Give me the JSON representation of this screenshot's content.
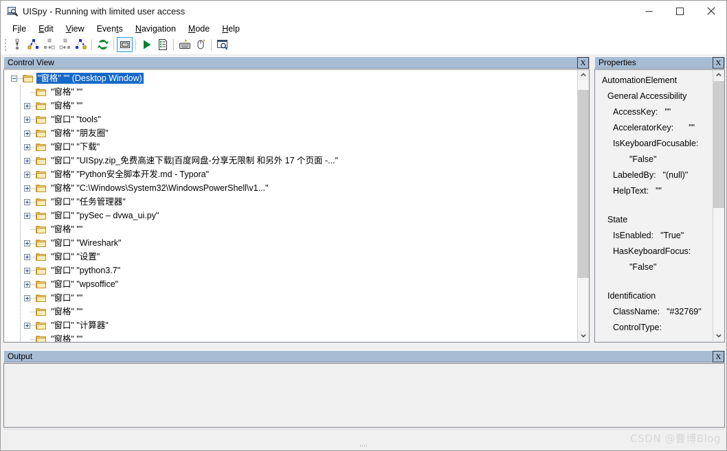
{
  "window": {
    "title": "UISpy - Running with limited user access",
    "icon": "uispy-app-icon",
    "controls": {
      "minimize": "minimize-icon",
      "maximize": "maximize-icon",
      "close": "close-icon"
    }
  },
  "menu": {
    "items": [
      {
        "label": "File",
        "pre": "F",
        "accel": "i",
        "post": "le"
      },
      {
        "label": "Edit",
        "pre": "",
        "accel": "E",
        "post": "dit"
      },
      {
        "label": "View",
        "pre": "",
        "accel": "V",
        "post": "iew"
      },
      {
        "label": "Events",
        "pre": "Even",
        "accel": "t",
        "post": "s"
      },
      {
        "label": "Navigation",
        "pre": "",
        "accel": "N",
        "post": "avigation"
      },
      {
        "label": "Mode",
        "pre": "",
        "accel": "M",
        "post": "ode"
      },
      {
        "label": "Help",
        "pre": "",
        "accel": "H",
        "post": "elp"
      }
    ]
  },
  "toolbar": {
    "buttons": [
      {
        "name": "select-parent-icon",
        "selected": false
      },
      {
        "name": "navigate-ancestor-icon",
        "selected": false
      },
      {
        "name": "navigate-previous-sibling-icon",
        "selected": false
      },
      {
        "name": "navigate-next-sibling-icon",
        "selected": false
      },
      {
        "name": "navigate-descendant-icon",
        "selected": false
      },
      {
        "name": "refresh-icon",
        "selected": false
      },
      {
        "name": "highlight-element-icon",
        "selected": true
      },
      {
        "name": "run-icon",
        "selected": false
      },
      {
        "name": "properties-list-icon",
        "selected": false
      },
      {
        "name": "keyboard-focus-tracking-icon",
        "selected": false
      },
      {
        "name": "mouse-hover-tracking-icon",
        "selected": false
      },
      {
        "name": "find-element-icon",
        "selected": false
      }
    ]
  },
  "control_view": {
    "title": "Control View",
    "close_label": "X",
    "tree": [
      {
        "indent": 0,
        "expander": "minus",
        "label": "\"窗格\" \"\" (Desktop Window)",
        "selected": true
      },
      {
        "indent": 1,
        "expander": "none",
        "label": "\"窗格\" \"\"",
        "selected": false
      },
      {
        "indent": 1,
        "expander": "plus",
        "label": "\"窗格\" \"\"",
        "selected": false
      },
      {
        "indent": 1,
        "expander": "plus",
        "label": "\"窗口\" \"tools\"",
        "selected": false
      },
      {
        "indent": 1,
        "expander": "plus",
        "label": "\"窗格\" \"朋友圈\"",
        "selected": false
      },
      {
        "indent": 1,
        "expander": "plus",
        "label": "\"窗口\" \"下载\"",
        "selected": false
      },
      {
        "indent": 1,
        "expander": "plus",
        "label": "\"窗口\" \"UISpy.zip_免费高速下载|百度网盘-分享无限制 和另外 17 个页面 -...\"",
        "selected": false
      },
      {
        "indent": 1,
        "expander": "plus",
        "label": "\"窗格\" \"Python安全脚本开发.md - Typora\"",
        "selected": false
      },
      {
        "indent": 1,
        "expander": "plus",
        "label": "\"窗格\" \"C:\\Windows\\System32\\WindowsPowerShell\\v1...\"",
        "selected": false
      },
      {
        "indent": 1,
        "expander": "plus",
        "label": "\"窗口\" \"任务管理器\"",
        "selected": false
      },
      {
        "indent": 1,
        "expander": "plus",
        "label": "\"窗口\" \"pySec – dvwa_ui.py\"",
        "selected": false
      },
      {
        "indent": 1,
        "expander": "none",
        "label": "\"窗格\" \"\"",
        "selected": false
      },
      {
        "indent": 1,
        "expander": "plus",
        "label": "\"窗口\" \"Wireshark\"",
        "selected": false
      },
      {
        "indent": 1,
        "expander": "plus",
        "label": "\"窗口\" \"设置\"",
        "selected": false
      },
      {
        "indent": 1,
        "expander": "plus",
        "label": "\"窗口\" \"python3.7\"",
        "selected": false
      },
      {
        "indent": 1,
        "expander": "plus",
        "label": "\"窗口\" \"wpsoffice\"",
        "selected": false
      },
      {
        "indent": 1,
        "expander": "plus",
        "label": "\"窗口\" \"\"",
        "selected": false
      },
      {
        "indent": 1,
        "expander": "none",
        "label": "\"窗格\" \"\"",
        "selected": false
      },
      {
        "indent": 1,
        "expander": "plus",
        "label": "\"窗口\" \"计算器\"",
        "selected": false
      },
      {
        "indent": 1,
        "expander": "none",
        "label": "\"窗格\" \"\"",
        "selected": false
      }
    ]
  },
  "properties": {
    "title": "Properties",
    "close_label": "X",
    "rows": [
      {
        "level": 0,
        "label": "AutomationElement",
        "value": ""
      },
      {
        "level": 1,
        "label": "General Accessibility",
        "value": ""
      },
      {
        "level": 2,
        "label": "AccessKey:",
        "value": "\"\""
      },
      {
        "level": 2,
        "label": "AcceleratorKey:",
        "value": "\"\"",
        "wide": true
      },
      {
        "level": 2,
        "label": "IsKeyboardFocusable:",
        "value": ""
      },
      {
        "level": 3,
        "label": "\"False\"",
        "value": ""
      },
      {
        "level": 2,
        "label": "LabeledBy:",
        "value": "\"(null)\""
      },
      {
        "level": 2,
        "label": "HelpText:",
        "value": "\"\""
      },
      {
        "level": -1,
        "label": "",
        "value": ""
      },
      {
        "level": 1,
        "label": "State",
        "value": ""
      },
      {
        "level": 2,
        "label": "IsEnabled:",
        "value": "\"True\""
      },
      {
        "level": 2,
        "label": "HasKeyboardFocus:",
        "value": ""
      },
      {
        "level": 3,
        "label": "\"False\"",
        "value": ""
      },
      {
        "level": -1,
        "label": "",
        "value": ""
      },
      {
        "level": 1,
        "label": "Identification",
        "value": ""
      },
      {
        "level": 2,
        "label": "ClassName:",
        "value": "\"#32769\""
      },
      {
        "level": 2,
        "label": "ControlType:",
        "value": ""
      }
    ]
  },
  "output": {
    "title": "Output",
    "close_label": "X",
    "content": ""
  },
  "watermark": "CSDN @曹博Blog",
  "colors": {
    "panel_header": "#a8bcd4",
    "selection": "#1669c8",
    "toolbar_selected_border": "#3399dd",
    "folder_fill": "#fdecb8",
    "folder_border": "#c18e22",
    "window_bg": "#f0f0f0",
    "tree_bg": "#ffffff"
  }
}
